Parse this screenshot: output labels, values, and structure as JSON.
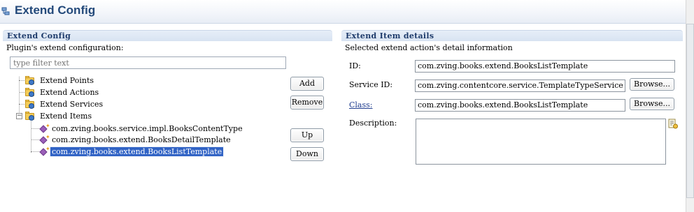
{
  "header": {
    "title": "Extend Config",
    "icon": "config-editor-icon"
  },
  "left": {
    "section_title": "Extend Config",
    "description": "Plugin's extend configuration:",
    "filter": {
      "placeholder": "type filter text",
      "value": ""
    },
    "tree": {
      "roots": [
        {
          "label": "Extend Points",
          "icon": "folder-icon"
        },
        {
          "label": "Extend Actions",
          "icon": "folder-icon"
        },
        {
          "label": "Extend Services",
          "icon": "folder-icon"
        },
        {
          "label": "Extend Items",
          "icon": "folder-icon",
          "expanded": true
        }
      ],
      "children": [
        {
          "label": "com.zving.books.service.impl.BooksContentType",
          "selected": false
        },
        {
          "label": "com.zving.books.extend.BooksDetailTemplate",
          "selected": false
        },
        {
          "label": "com.zving.books.extend.BooksListTemplate",
          "selected": true
        }
      ]
    },
    "buttons": {
      "add": "Add",
      "remove": "Remove",
      "up": "Up",
      "down": "Down"
    }
  },
  "right": {
    "section_title": "Extend Item details",
    "description": "Selected extend action's detail information",
    "fields": {
      "id_label": "ID:",
      "id_value": "com.zving.books.extend.BooksListTemplate",
      "service_label": "Service ID:",
      "service_value": "com.zving.contentcore.service.TemplateTypeService",
      "class_label": "Class:",
      "class_value": "com.zving.books.extend.BooksListTemplate",
      "description_label": "Description:",
      "description_value": ""
    },
    "browse_label": "Browse..."
  },
  "colors": {
    "accent_title": "#23497a",
    "section_title": "#1e3b6b",
    "selection": "#3163c5"
  }
}
